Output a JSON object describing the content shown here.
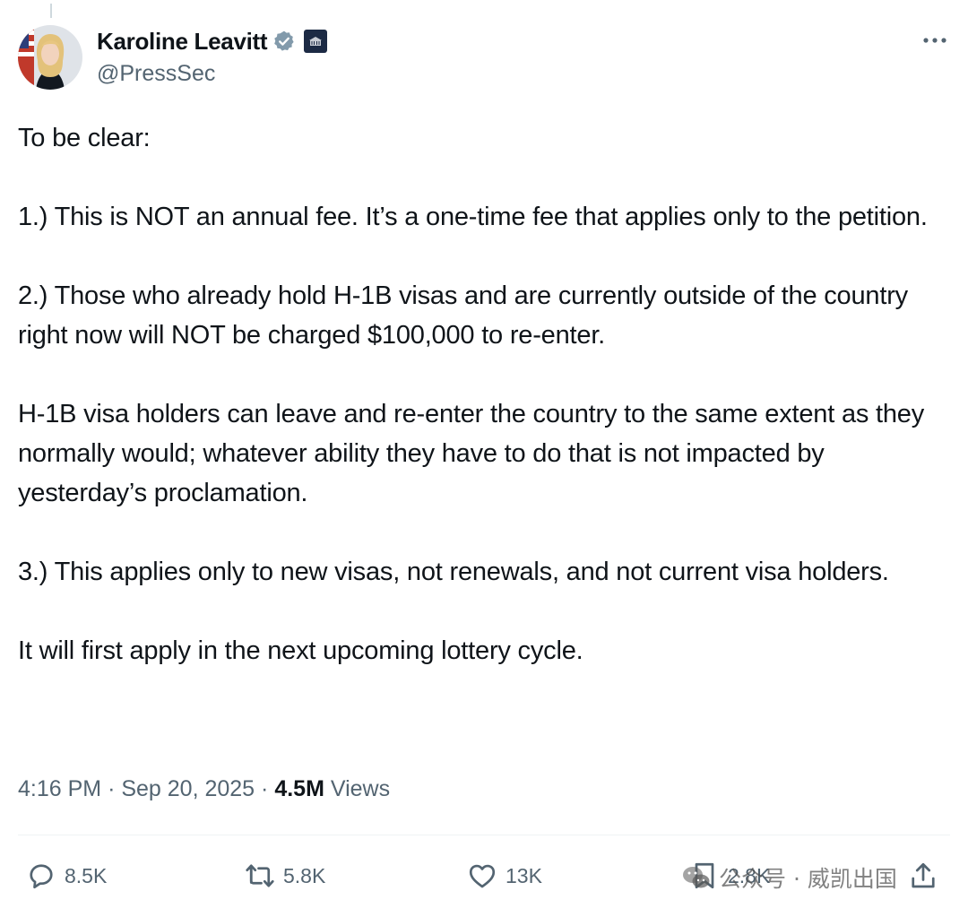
{
  "author": {
    "name": "Karoline Leavitt",
    "handle": "@PressSec",
    "affiliate_badge": "THE WHITE HOUSE",
    "verified_color": "#829aab"
  },
  "tweet": {
    "paragraphs": [
      "To be clear:",
      "1.) This is NOT an annual fee. It’s a one-time fee that applies only to the petition.",
      "2.) Those who already hold H-1B visas and are currently outside of the country right now will NOT be charged $100,000 to re-enter.",
      "H-1B visa holders can leave and re-enter the country to the same extent as they normally would; whatever ability they have to do that is not impacted by yesterday’s proclamation.",
      "3.) This applies only to new visas, not renewals, and not current visa holders.",
      "It will first apply in the next upcoming lottery cycle."
    ],
    "time": "4:16 PM",
    "date": "Sep 20, 2025",
    "separator": "·",
    "views_count": "4.5M",
    "views_label": "Views"
  },
  "actions": {
    "replies": "8.5K",
    "retweets": "5.8K",
    "likes": "13K",
    "bookmarks": "2.8K"
  },
  "watermark": {
    "text": "公众号 · 威凯出国"
  },
  "icons": [
    "verified-icon",
    "white-house-badge-icon",
    "more-icon",
    "reply-icon",
    "retweet-icon",
    "like-icon",
    "bookmark-icon",
    "share-icon",
    "wechat-icon"
  ]
}
